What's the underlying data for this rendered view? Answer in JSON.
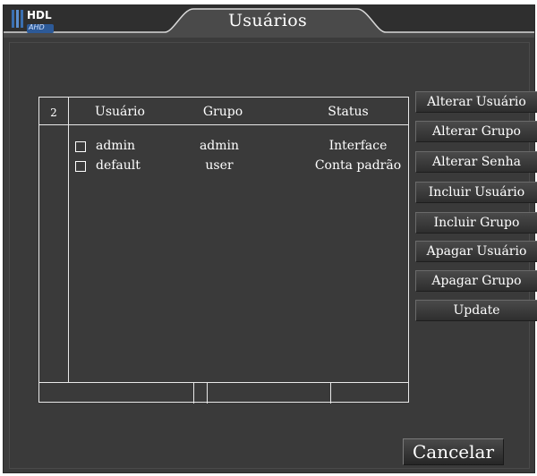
{
  "window": {
    "title": "Usuários",
    "logo_text": "HDL",
    "logo_sub": "AHD"
  },
  "table": {
    "header": {
      "index": "2",
      "user": "Usuário",
      "group": "Grupo",
      "status": "Status"
    },
    "rows": [
      {
        "user": "admin",
        "group": "admin",
        "status": "Interface",
        "checked": false
      },
      {
        "user": "default",
        "group": "user",
        "status": "Conta padrão",
        "checked": false
      }
    ]
  },
  "buttons": {
    "alter_user": "Alterar Usuário",
    "alter_group": "Alterar Grupo",
    "alter_password": "Alterar Senha",
    "add_user": "Incluir Usuário",
    "add_group": "Incluir Grupo",
    "delete_user": "Apagar Usuário",
    "delete_group": "Apagar Grupo",
    "update": "Update",
    "cancel": "Cancelar"
  },
  "colors": {
    "background": "#3b3b3b",
    "text": "#ffffff",
    "grid_line": "#e8e8e8"
  }
}
